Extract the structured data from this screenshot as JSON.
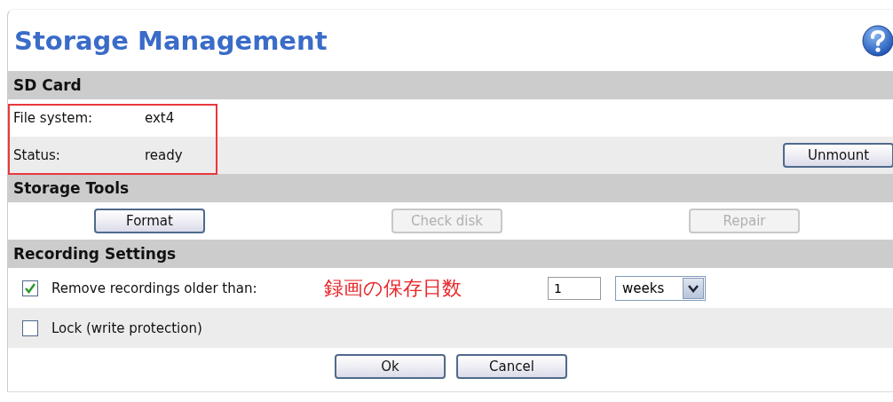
{
  "title": "Storage Management",
  "sd_card": {
    "heading": "SD Card",
    "highlighted": true,
    "fields": [
      {
        "label": "File system:",
        "value": "ext4"
      },
      {
        "label": "Status:",
        "value": "ready"
      }
    ],
    "unmount_button": "Unmount"
  },
  "storage_tools": {
    "heading": "Storage Tools",
    "buttons": [
      {
        "label": "Format",
        "disabled": false
      },
      {
        "label": "Check disk",
        "disabled": true
      },
      {
        "label": "Repair",
        "disabled": true
      }
    ]
  },
  "recording_settings": {
    "heading": "Recording Settings",
    "remove_old": {
      "label": "Remove recordings older than:",
      "checked": true,
      "annotation": "録画の保存日数",
      "value": "1",
      "unit": "weeks"
    },
    "lock": {
      "label": "Lock (write protection)",
      "checked": false
    }
  },
  "buttons": [
    "Ok",
    "Cancel"
  ]
}
